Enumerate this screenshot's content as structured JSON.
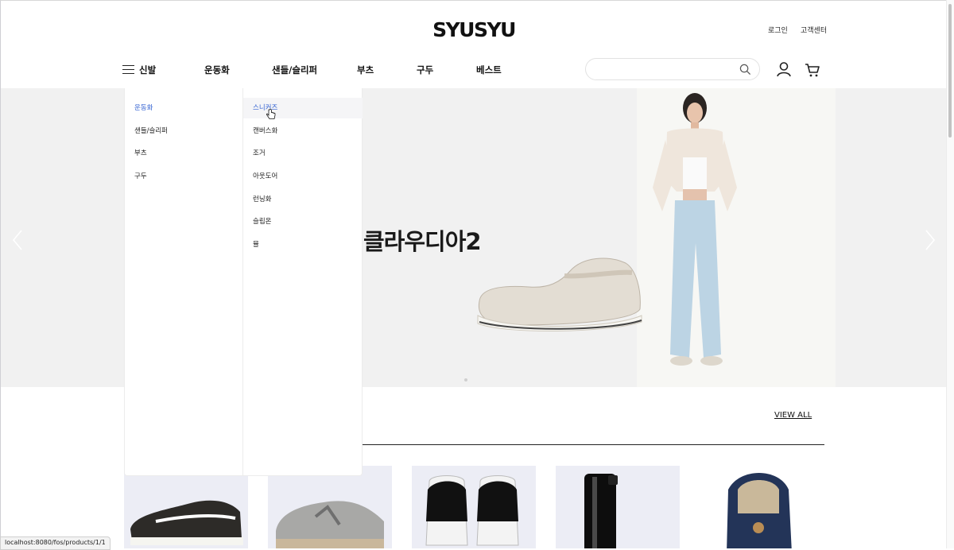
{
  "header": {
    "logo": "SYUSYU",
    "util_links": {
      "login": "로그인",
      "customer_center": "고객센터"
    }
  },
  "nav": {
    "menu_label": "신발",
    "items": [
      "운동화",
      "샌들/슬리퍼",
      "부츠",
      "구두",
      "베스트"
    ]
  },
  "search": {
    "placeholder": "",
    "value": ""
  },
  "icons": {
    "menu": "hamburger-icon",
    "search": "search-icon",
    "user": "user-icon",
    "cart": "cart-icon",
    "prev": "chevron-left-icon",
    "next": "chevron-right-icon",
    "pointer": "hand-pointer-cursor"
  },
  "hero": {
    "title": "클라우디아2"
  },
  "mega_menu": {
    "categories": [
      "운동화",
      "샌들/슬리퍼",
      "부츠",
      "구두"
    ],
    "active_category": "운동화",
    "subcategories": [
      "스니커즈",
      "캔버스화",
      "조거",
      "아웃도어",
      "런닝화",
      "슬립온",
      "뮬"
    ],
    "active_subcategory": "스니커즈"
  },
  "section": {
    "view_all": "VIEW ALL"
  },
  "status_bar": {
    "url": "localhost:8080/fos/products/1/1"
  },
  "colors": {
    "accent": "#2f5fd1",
    "hero_bg": "#f1f1f1",
    "product_bg": "#ecedf5"
  }
}
